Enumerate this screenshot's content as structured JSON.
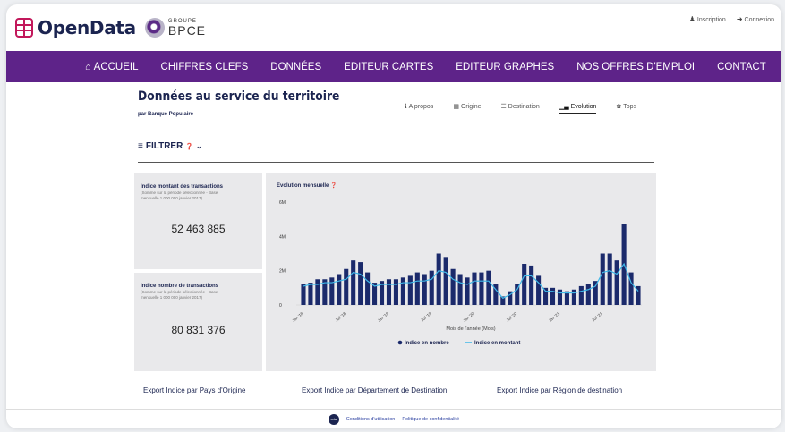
{
  "header": {
    "brand_name": "OpenData",
    "group_small": "GROUPE",
    "group_big": "BPCE",
    "auth": {
      "register": "Inscription",
      "login": "Connexion"
    }
  },
  "nav": {
    "items": [
      "ACCUEIL",
      "CHIFFRES CLEFS",
      "DONNÉES",
      "EDITEUR CARTES",
      "EDITEUR GRAPHES",
      "NOS OFFRES D'EMPLOI",
      "CONTACT"
    ]
  },
  "page": {
    "title": "Données au service du territoire",
    "subtitle": "par Banque Populaire",
    "filter_label": "FILTRER",
    "tabs": [
      {
        "icon": "info-icon",
        "label": "A propos"
      },
      {
        "icon": "map-icon",
        "label": "Origine"
      },
      {
        "icon": "signpost-icon",
        "label": "Destination"
      },
      {
        "icon": "chart-icon",
        "label": "Evolution"
      },
      {
        "icon": "trophy-icon",
        "label": "Tops"
      }
    ]
  },
  "cards": {
    "amount": {
      "title": "Indice montant des transactions",
      "note": "(Somme sur la période sélectionnée - Base mensuelle 1 000 000 janvier 2017)",
      "value": "52 463 885"
    },
    "count": {
      "title": "Indice nombre de transactions",
      "note": "(Somme sur la période sélectionnée - Base mensuelle 1 000 000 janvier 2017)",
      "value": "80 831 376"
    }
  },
  "chart_title": "Evolution mensuelle",
  "chart_data": {
    "type": "bar",
    "xlabel": "Mois de l'année (Mois)",
    "ylabel": "",
    "ylim": [
      0,
      6
    ],
    "y_ticks": [
      "0",
      "2M",
      "4M",
      "6M"
    ],
    "x_tick_labels": [
      "Jan '18",
      "Juil '18",
      "Jan '19",
      "Juil '19",
      "Jan '20",
      "Juil '20",
      "Jan '21",
      "Juil '21"
    ],
    "x_tick_month_index": [
      0,
      6,
      12,
      18,
      24,
      30,
      36,
      42
    ],
    "legend_position": "bottom",
    "series": [
      {
        "name": "Indice en nombre",
        "kind": "bar",
        "color": "#1b2a6b",
        "values": [
          1.2,
          1.3,
          1.5,
          1.5,
          1.6,
          1.8,
          2.1,
          2.6,
          2.5,
          1.9,
          1.3,
          1.4,
          1.5,
          1.5,
          1.6,
          1.7,
          1.9,
          1.8,
          2.0,
          3.0,
          2.8,
          2.1,
          1.8,
          1.6,
          1.9,
          1.9,
          2.0,
          1.2,
          0.5,
          0.8,
          1.2,
          2.4,
          2.3,
          1.7,
          1.0,
          1.0,
          0.9,
          0.8,
          0.9,
          1.1,
          1.2,
          1.4,
          3.0,
          3.0,
          2.6,
          4.7,
          1.9,
          1.1
        ]
      },
      {
        "name": "Indice en montant",
        "kind": "line",
        "color": "#3fb8e8",
        "values": [
          1.1,
          1.2,
          1.2,
          1.3,
          1.3,
          1.4,
          1.5,
          1.9,
          1.8,
          1.4,
          1.1,
          1.2,
          1.2,
          1.2,
          1.3,
          1.3,
          1.4,
          1.4,
          1.5,
          2.0,
          1.9,
          1.5,
          1.3,
          1.2,
          1.4,
          1.4,
          1.4,
          0.9,
          0.4,
          0.6,
          0.9,
          1.7,
          1.7,
          1.3,
          0.8,
          0.8,
          0.7,
          0.7,
          0.7,
          0.8,
          0.9,
          1.1,
          1.9,
          2.0,
          1.8,
          2.4,
          1.3,
          0.8
        ]
      }
    ]
  },
  "exports": [
    "Export Indice par Pays d'Origine",
    "Export Indice par Département de Destination",
    "Export Indice par Région de destination"
  ],
  "footer": {
    "badge": "cda",
    "terms": "Conditions d'utilisation",
    "privacy": "Politique de confidentialité"
  }
}
